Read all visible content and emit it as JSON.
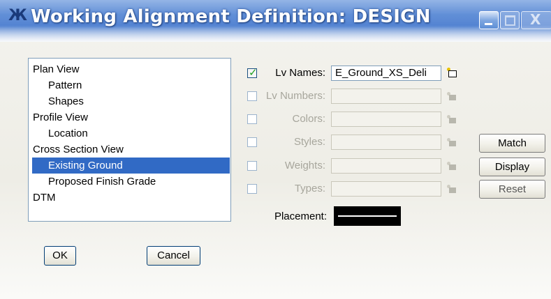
{
  "window": {
    "title": "Working Alignment Definition: DESIGN",
    "app_icon_glyph": "Ж",
    "close_glyph": "X",
    "accent_color": "#4c7fd1"
  },
  "tree": {
    "items": [
      {
        "label": "Plan View",
        "level": 0,
        "selected": false
      },
      {
        "label": "Pattern",
        "level": 1,
        "selected": false
      },
      {
        "label": "Shapes",
        "level": 1,
        "selected": false
      },
      {
        "label": "Profile View",
        "level": 0,
        "selected": false
      },
      {
        "label": "Location",
        "level": 1,
        "selected": false
      },
      {
        "label": "Cross Section View",
        "level": 0,
        "selected": false
      },
      {
        "label": "Existing Ground",
        "level": 1,
        "selected": true
      },
      {
        "label": "Proposed Finish Grade",
        "level": 1,
        "selected": false
      },
      {
        "label": "DTM",
        "level": 0,
        "selected": false
      }
    ],
    "selection_color": "#316ac5"
  },
  "rows": [
    {
      "label": "Lv Names:",
      "checked": true,
      "enabled": true,
      "value": "E_Ground_XS_Deli"
    },
    {
      "label": "Lv Numbers:",
      "checked": false,
      "enabled": false,
      "value": ""
    },
    {
      "label": "Colors:",
      "checked": false,
      "enabled": false,
      "value": ""
    },
    {
      "label": "Styles:",
      "checked": false,
      "enabled": false,
      "value": ""
    },
    {
      "label": "Weights:",
      "checked": false,
      "enabled": false,
      "value": ""
    },
    {
      "label": "Types:",
      "checked": false,
      "enabled": false,
      "value": ""
    }
  ],
  "placement": {
    "label": "Placement:"
  },
  "buttons": {
    "match": "Match",
    "display": "Display",
    "reset": "Reset",
    "ok": "OK",
    "cancel": "Cancel"
  }
}
